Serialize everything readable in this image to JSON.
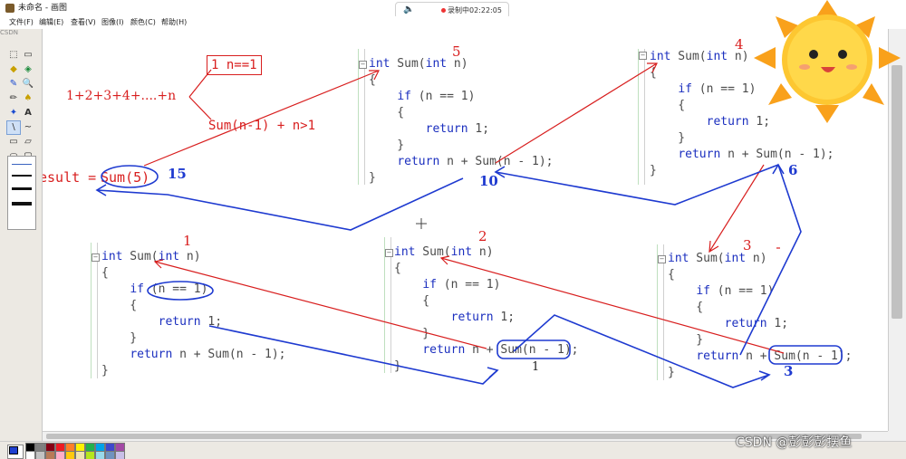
{
  "window": {
    "title": "未命名 - 画图"
  },
  "recording": {
    "text": "录制中02:22:05",
    "speaker_icon": "speaker-icon"
  },
  "menu": [
    "文件(F)",
    "编辑(E)",
    "查看(V)",
    "图像(I)",
    "颜色(C)",
    "帮助(H)"
  ],
  "overlay_logo": "CSDN",
  "watermark": "CSDN @彭彭彭摆鱼",
  "code_blocks": [
    {
      "id": "sum5",
      "lines": [
        "int Sum(int n)",
        "{",
        "    if (n == 1)",
        "    {",
        "        return 1;",
        "    }",
        "    return n + Sum(n - 1);",
        "}"
      ]
    },
    {
      "id": "sum4",
      "lines": [
        "int Sum(int n)",
        "{",
        "    if (n == 1)",
        "    {",
        "        return 1;",
        "    }",
        "    return n + Sum(n - 1);",
        "}"
      ]
    },
    {
      "id": "sum1",
      "lines": [
        "int Sum(int n)",
        "{",
        "    if (n == 1)",
        "    {",
        "        return 1;",
        "    }",
        "    return n + Sum(n - 1);",
        "}"
      ]
    },
    {
      "id": "sum2",
      "lines": [
        "int Sum(int n)",
        "{",
        "    if (n == 1)",
        "    {",
        "        return 1;",
        "    }",
        "    return n + Sum(n - 1);",
        "}"
      ]
    },
    {
      "id": "sum3",
      "lines": [
        "int Sum(int n)",
        "{",
        "    if (n == 1)",
        "    {",
        "        return 1;",
        "    }",
        "    return n + Sum(n - 1);",
        "}"
      ]
    }
  ],
  "annotations": {
    "series": "1+2+3+4+....+n",
    "base_case": "1 n==1",
    "recursive_case": "Sum(n-1) + n>1",
    "result_label": "esult = ",
    "result_call": "Sum(5)",
    "result_value": "15",
    "num_5": "5",
    "num_4": "4",
    "num_1": "1",
    "num_2": "2",
    "num_3": "3",
    "ret_10": "10",
    "ret_6": "6",
    "ret_3": "3",
    "ret_1": "1"
  },
  "colors": {
    "red_ink": "#d81e1e",
    "blue_ink": "#1e3ad0",
    "keyword": "#1b2fbf",
    "csdn_blue": "#1a86d8"
  },
  "palette": [
    "#000000",
    "#7f7f7f",
    "#880015",
    "#ed1c24",
    "#ff7f27",
    "#fff200",
    "#22b14c",
    "#00a2e8",
    "#3f48cc",
    "#a349a4",
    "#ffffff",
    "#c3c3c3",
    "#b97a57",
    "#ffaec9",
    "#ffc90e",
    "#efe4b0",
    "#b5e61d",
    "#99d9ea",
    "#7092be",
    "#c8bfe7"
  ]
}
